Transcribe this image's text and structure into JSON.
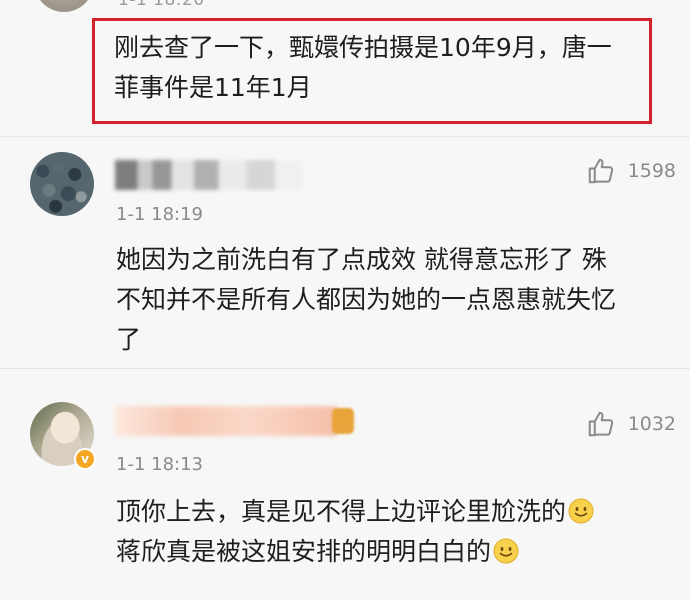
{
  "top_comment": {
    "time_cut": "1-1 18:20",
    "text_line1": "刚去查了一下，甄嬛传拍摄是10年9月，唐一",
    "text_line2": "菲事件是11年1月"
  },
  "comments": [
    {
      "time": "1-1 18:19",
      "likes": "1598",
      "text_line1": "她因为之前洗白有了点成效 就得意忘形了  殊",
      "text_line2": "不知并不是所有人都因为她的一点恩惠就失忆",
      "text_line3": "了"
    },
    {
      "time": "1-1 18:13",
      "likes": "1032",
      "text_line1": "顶你上去，真是见不得上边评论里尬洗的",
      "text_line2": "蒋欣真是被这姐安排的明明白白的",
      "emoji": "smiley-emoji"
    }
  ],
  "colors": {
    "highlight_border": "#d2232a",
    "meta_text": "#8a8a8a",
    "body_text": "#1e1e1e",
    "verified_badge": "#f5a623"
  },
  "icons": {
    "like": "thumbs-up-icon",
    "emoji": "smiley-emoji",
    "verified": "verified-badge-icon"
  }
}
